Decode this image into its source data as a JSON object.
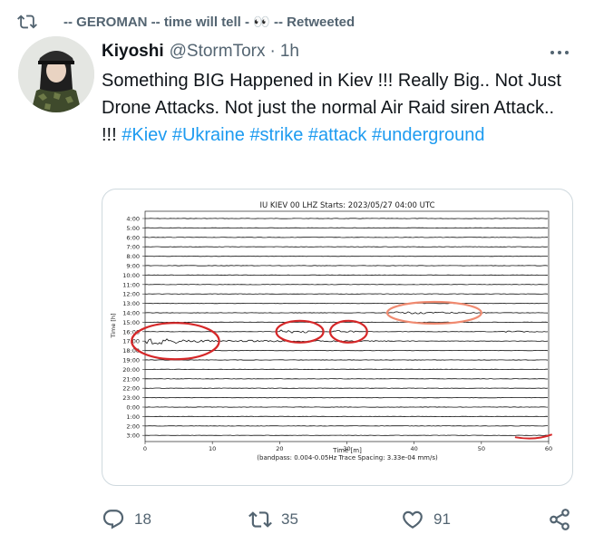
{
  "retweet": {
    "icon": "retweet-icon",
    "text": "-- GEROMAN -- time will tell - 👀 -- Retweeted"
  },
  "tweet": {
    "name": "Kiyoshi",
    "handle": "@StormTorx",
    "separator": "·",
    "time": "1h",
    "text_plain": "Something BIG Happened in Kiev !!! Really  Big.. Not Just Drone Attacks. Not just the normal Air Raid siren Attack.. !!! ",
    "hashtags": [
      "#Kiev",
      "#Ukraine",
      "#strike",
      "#attack",
      "#underground"
    ]
  },
  "seismogram": {
    "title": "IU KIEV 00 LHZ  Starts: 2023/05/27 04:00 UTC",
    "ylabel": "Time [h]",
    "xlabel": "Time [m]",
    "note": "(bandpass: 0.004-0.05Hz  Trace Spacing: 3.33e-04 mm/s)",
    "hour_labels": [
      "4:00",
      "5:00",
      "6:00",
      "7:00",
      "8:00",
      "9:00",
      "10:00",
      "11:00",
      "12:00",
      "13:00",
      "14:00",
      "15:00",
      "16:00",
      "17:00",
      "18:00",
      "19:00",
      "20:00",
      "21:00",
      "22:00",
      "23:00",
      "0:00",
      "1:00",
      "2:00",
      "3:00"
    ],
    "x_ticks": [
      "0",
      "10",
      "20",
      "30",
      "40",
      "50",
      "60"
    ],
    "x_range": [
      0,
      60
    ],
    "annotation_color": "#d62728",
    "highlight_color": "#f08a70"
  },
  "actions": {
    "reply": {
      "icon": "reply-icon",
      "count": "18"
    },
    "retweet": {
      "icon": "retweet-icon",
      "count": "35"
    },
    "like": {
      "icon": "heart-icon",
      "count": "91"
    },
    "share": {
      "icon": "share-icon"
    }
  },
  "colors": {
    "accent": "#1d9bf0",
    "secondary_text": "#536471",
    "primary_text": "#0f1419"
  }
}
